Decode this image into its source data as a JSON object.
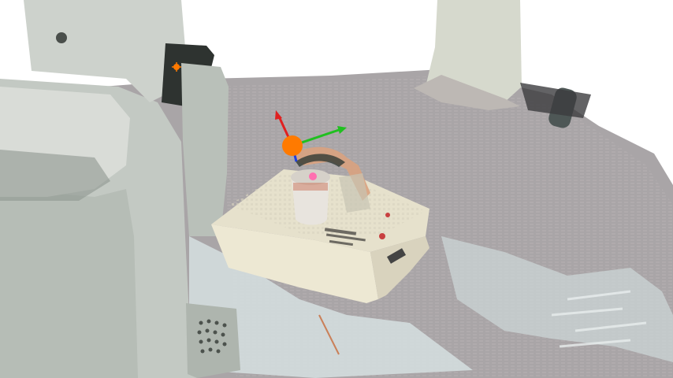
{
  "scene": {
    "description_none": "",
    "colors": {
      "background": "#ffffff",
      "table": "#aaa6a8",
      "robot_body": "#c9cfc9",
      "robot_shadow": "#9ea6a0",
      "box": "#ece6cf",
      "cup": "#e6e2dc",
      "handle": "#d29a76",
      "marker_orange": "#ff7a00",
      "axis_x": "#e02020",
      "axis_y": "#20c020",
      "axis_z": "#2040e0",
      "pink_point": "#ff70b0"
    },
    "icons": [
      "gripper-frame-marker",
      "axis-x-arrow",
      "axis-y-arrow",
      "axis-z-arrow",
      "orange-keypoint",
      "pink-keypoint"
    ]
  }
}
